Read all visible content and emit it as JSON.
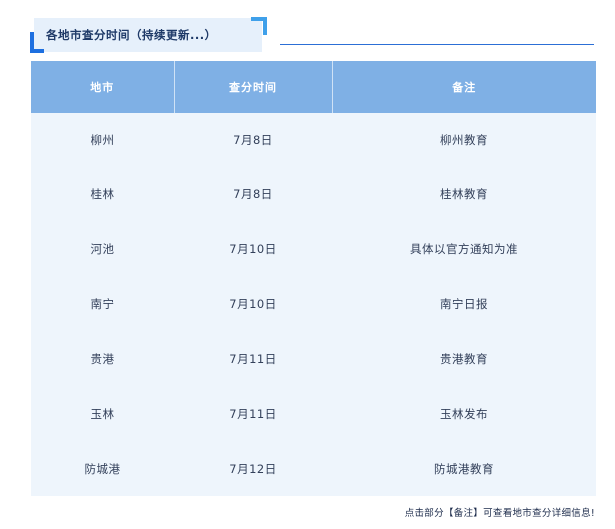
{
  "header": {
    "title": "各地市查分时间（持续更新...）"
  },
  "table": {
    "columns": [
      "地市",
      "查分时间",
      "备注"
    ],
    "rows": [
      [
        "柳州",
        "7月8日",
        "柳州教育"
      ],
      [
        "桂林",
        "7月8日",
        "桂林教育"
      ],
      [
        "河池",
        "7月10日",
        "具体以官方通知为准"
      ],
      [
        "南宁",
        "7月10日",
        "南宁日报"
      ],
      [
        "贵港",
        "7月11日",
        "贵港教育"
      ],
      [
        "玉林",
        "7月11日",
        "玉林发布"
      ],
      [
        "防城港",
        "7月12日",
        "防城港教育"
      ]
    ]
  },
  "footer": {
    "note": "点击部分【备注】可查看地市查分详细信息!"
  },
  "colors": {
    "header_bg": "#7fb0e5",
    "row_bg": "#eef5fc",
    "accent": "#1d6fe0",
    "title_bg": "#e6f0fb"
  }
}
